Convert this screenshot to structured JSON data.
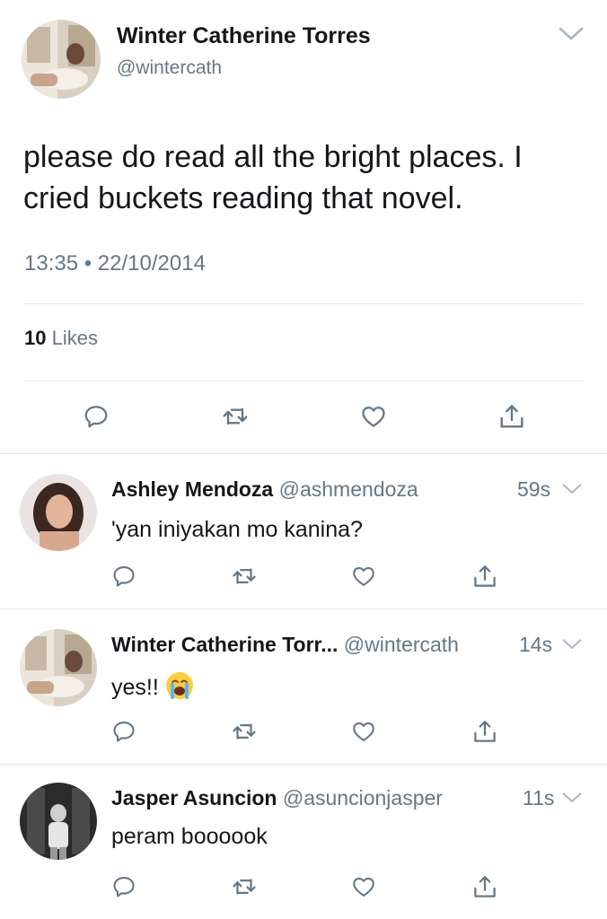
{
  "main_tweet": {
    "author_name": "Winter Catherine Torres",
    "author_handle": "@wintercath",
    "text": "please do read all the bright places. I cried buckets reading that novel.",
    "timestamp": "13:35 • 22/10/2014",
    "likes_count": "10",
    "likes_label": "Likes"
  },
  "replies": [
    {
      "author_name": "Ashley Mendoza",
      "author_handle": "@ashmendoza",
      "time": "59s",
      "text": "'yan iniyakan mo kanina?"
    },
    {
      "author_name": "Winter Catherine Torr...",
      "author_handle": "@wintercath",
      "time": "14s",
      "text": "yes!!",
      "emoji": "loudly-crying-face"
    },
    {
      "author_name": "Jasper Asuncion",
      "author_handle": "@asuncionjasper",
      "time": "11s",
      "text": "peram boooook"
    }
  ],
  "icons": {
    "reply": "reply-icon",
    "retweet": "retweet-icon",
    "like": "like-icon",
    "share": "share-icon",
    "chevron": "chevron-down-icon"
  },
  "colors": {
    "text": "#14171a",
    "secondary": "#657786",
    "divider": "#e1e8ed",
    "background": "#ffffff"
  }
}
